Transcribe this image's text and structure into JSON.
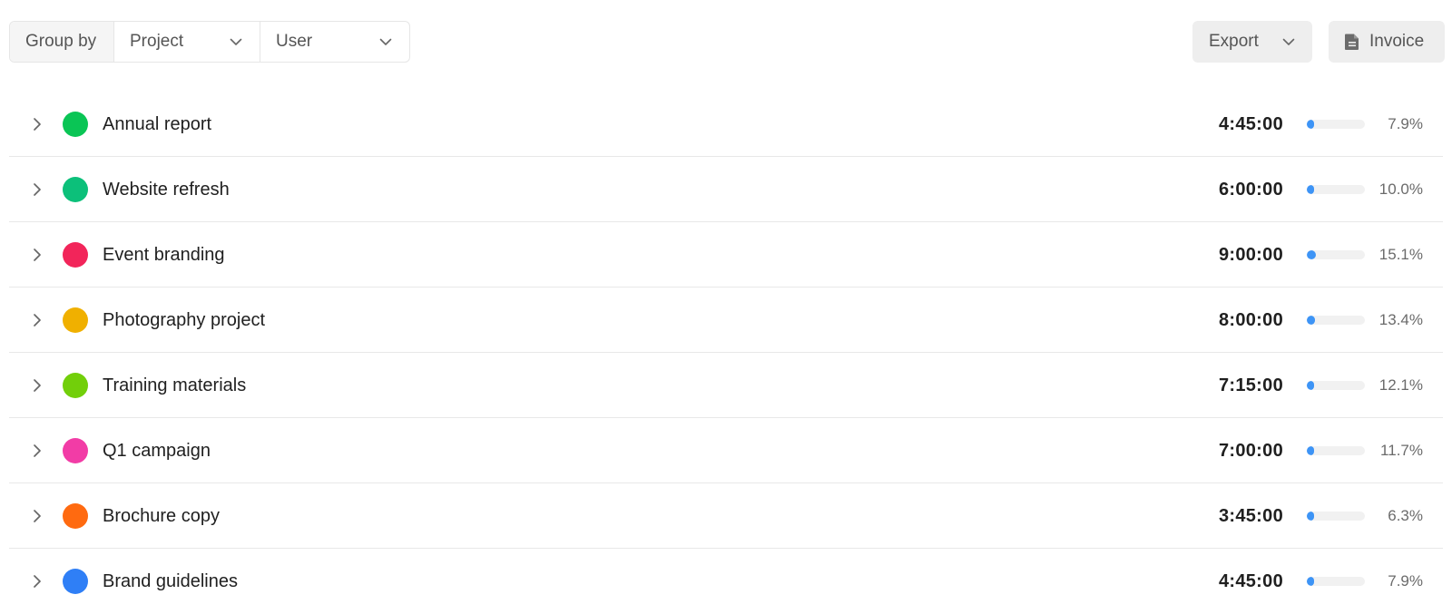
{
  "toolbar": {
    "group_by_label": "Group by",
    "project_select": "Project",
    "user_select": "User",
    "export_label": "Export",
    "invoice_label": "Invoice"
  },
  "rows": [
    {
      "name": "Annual report",
      "duration": "4:45:00",
      "percent": "7.9%",
      "fraction": 0.079,
      "color": "#0ac555"
    },
    {
      "name": "Website refresh",
      "duration": "6:00:00",
      "percent": "10.0%",
      "fraction": 0.1,
      "color": "#0cc07a"
    },
    {
      "name": "Event branding",
      "duration": "9:00:00",
      "percent": "15.1%",
      "fraction": 0.151,
      "color": "#f2255a"
    },
    {
      "name": "Photography project",
      "duration": "8:00:00",
      "percent": "13.4%",
      "fraction": 0.134,
      "color": "#f0b000"
    },
    {
      "name": "Training materials",
      "duration": "7:15:00",
      "percent": "12.1%",
      "fraction": 0.121,
      "color": "#72cf0a"
    },
    {
      "name": "Q1 campaign",
      "duration": "7:00:00",
      "percent": "11.7%",
      "fraction": 0.117,
      "color": "#f23ca6"
    },
    {
      "name": "Brochure copy",
      "duration": "3:45:00",
      "percent": "6.3%",
      "fraction": 0.063,
      "color": "#ff6a10"
    },
    {
      "name": "Brand guidelines",
      "duration": "4:45:00",
      "percent": "7.9%",
      "fraction": 0.079,
      "color": "#2f7ff6"
    }
  ],
  "icons": {
    "expand": "chevron-right-icon",
    "dropdown": "chevron-down-icon",
    "invoice": "document-icon"
  },
  "colors": {
    "progress": "#3d94f6",
    "progress_track": "#f1f1f1"
  }
}
